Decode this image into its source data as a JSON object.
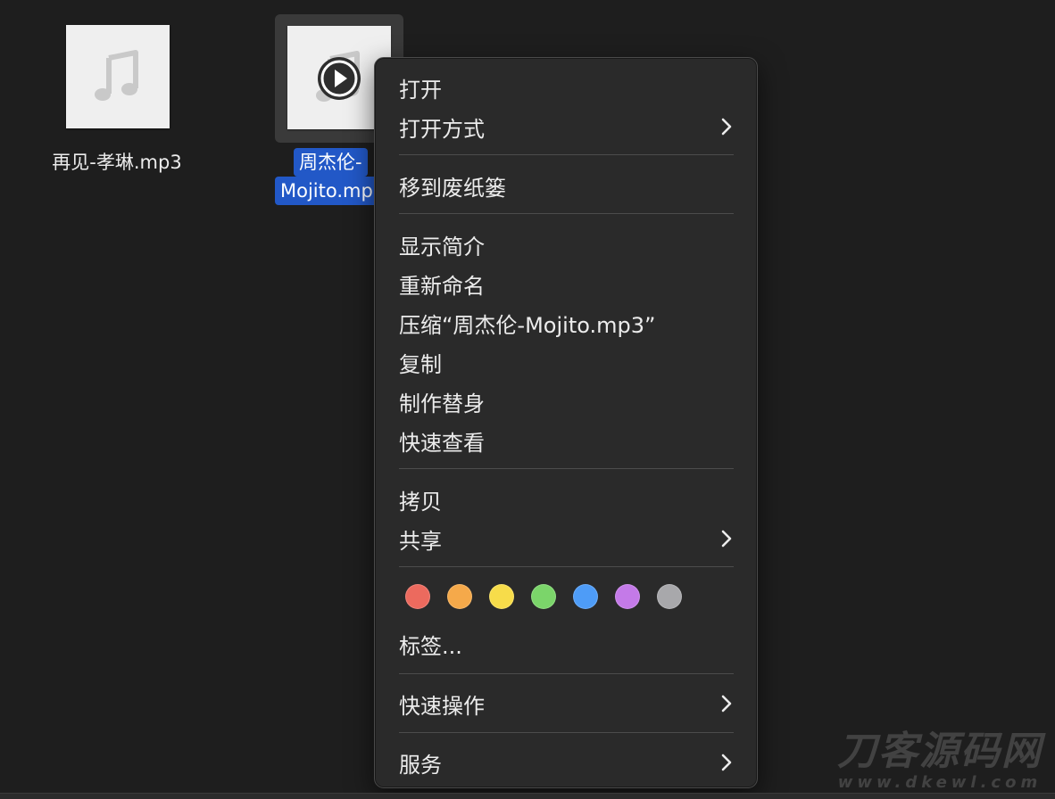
{
  "files": [
    {
      "name": "再见-孝琳.mp3",
      "selected": false
    },
    {
      "name_line1": "周杰伦-",
      "name_line2": "Mojito.mp",
      "selected": true
    }
  ],
  "menu": {
    "open": "打开",
    "open_with": "打开方式",
    "move_to_trash": "移到废纸篓",
    "get_info": "显示简介",
    "rename": "重新命名",
    "compress": "压缩“周杰伦-Mojito.mp3”",
    "duplicate": "复制",
    "make_alias": "制作替身",
    "quick_look": "快速查看",
    "copy": "拷贝",
    "share": "共享",
    "tags_label": "标签...",
    "quick_actions": "快速操作",
    "services": "服务",
    "tag_colors": [
      "#ec6a5e",
      "#f5a94a",
      "#f7dc4a",
      "#7bd56a",
      "#4e9cf7",
      "#c47ae8",
      "#a8a8ab"
    ]
  },
  "watermark": {
    "main": "刀客源码网",
    "sub": "www.dkewl.com"
  }
}
